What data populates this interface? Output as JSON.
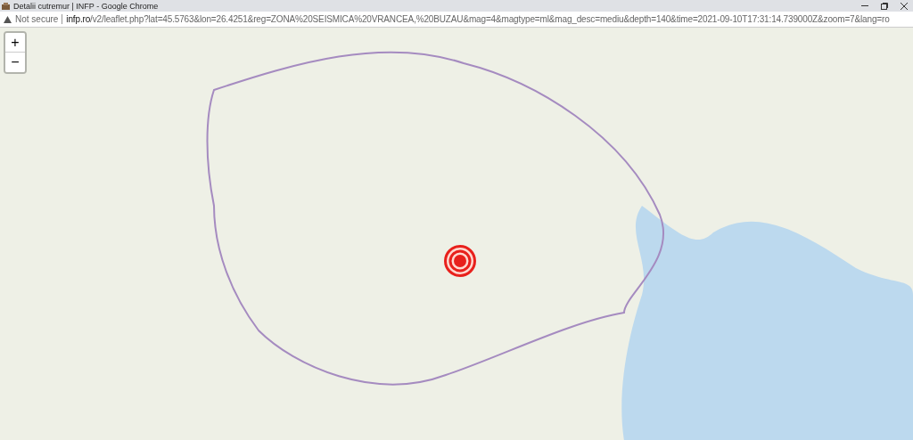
{
  "window": {
    "title": "Detalii cutremur | INFP - Google Chrome"
  },
  "address_bar": {
    "security": "Not secure",
    "host": "infp.ro",
    "path": "/v2/leaflet.php?lat=45.5763&lon=26.4251&reg=ZONA%20SEISMICA%20VRANCEA,%20BUZAU&mag=4&magtype=ml&mag_desc=mediu&depth=140&time=2021-09-10T17:31:14.739000Z&zoom=7&lang=ro"
  },
  "map": {
    "zoom_controls": [
      "+",
      "−"
    ]
  }
}
